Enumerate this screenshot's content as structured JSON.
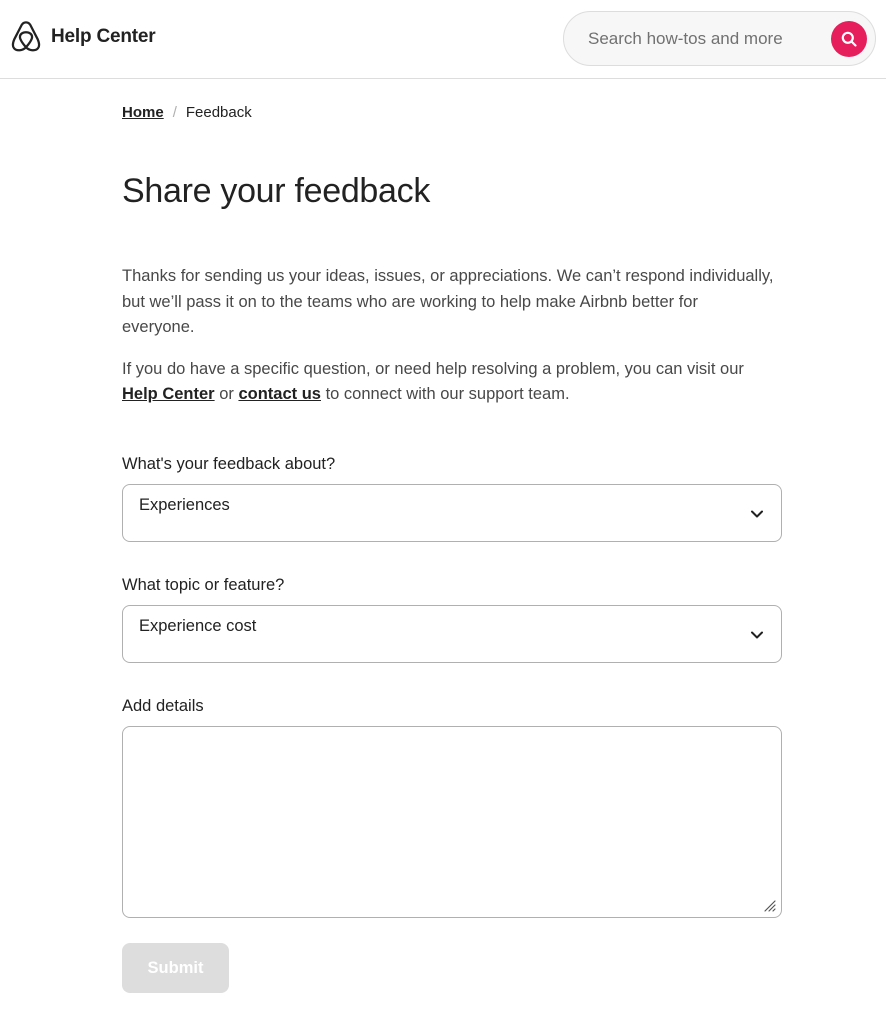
{
  "header": {
    "brand_title": "Help Center",
    "logo_icon": "airbnb-logo-icon",
    "search": {
      "placeholder": "Search how-tos and more",
      "value": "",
      "button_icon": "search-icon",
      "button_color": "#e61e5c"
    }
  },
  "breadcrumb": {
    "home": "Home",
    "separator": "/",
    "current": "Feedback"
  },
  "page": {
    "title": "Share your feedback",
    "intro_1": "Thanks for sending us your ideas, issues, or appreciations. We can’t respond individually, but we’ll pass it on to the teams who are working to help make Airbnb better for everyone.",
    "intro_2_before": "If you do have a specific question, or need help resolving a problem, you can visit our ",
    "help_center_link": "Help Center",
    "intro_2_middle": " or ",
    "contact_link": "contact us",
    "intro_2_after": " to connect with our support team."
  },
  "form": {
    "feedback_about": {
      "label": "What's your feedback about?",
      "value": "Experiences"
    },
    "topic": {
      "label": "What topic or feature?",
      "value": "Experience cost"
    },
    "details": {
      "label": "Add details",
      "value": ""
    },
    "submit_label": "Submit",
    "submit_enabled": false
  },
  "colors": {
    "accent": "#e61e5c",
    "text": "#222222",
    "secondary_text": "#484848",
    "border": "#b0b0b0",
    "disabled_button": "#dddddd"
  }
}
